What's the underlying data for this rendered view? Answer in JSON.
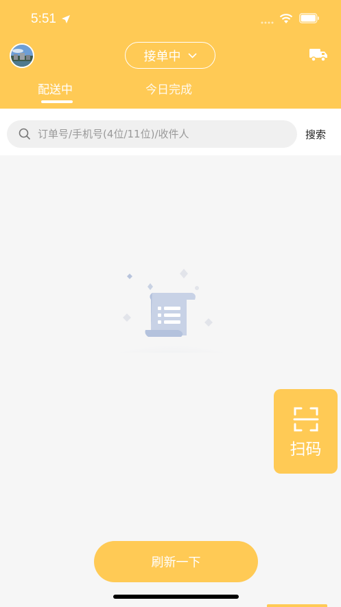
{
  "status_bar": {
    "time": "5:51"
  },
  "header": {
    "status_dropdown": "接单中",
    "tabs": [
      {
        "label": "配送中",
        "active": true
      },
      {
        "label": "今日完成",
        "active": false
      }
    ]
  },
  "search": {
    "placeholder": "订单号/手机号(4位/11位)/收件人",
    "button_label": "搜索"
  },
  "scan_button": {
    "label": "扫码"
  },
  "refresh_button": {
    "label": "刷新一下"
  },
  "colors": {
    "accent": "#ffca55",
    "background": "#f6f6f6"
  },
  "icons": [
    "location-arrow-icon",
    "signal-icon",
    "wifi-icon",
    "battery-icon",
    "truck-icon",
    "search-icon",
    "scan-icon",
    "empty-list-icon"
  ]
}
